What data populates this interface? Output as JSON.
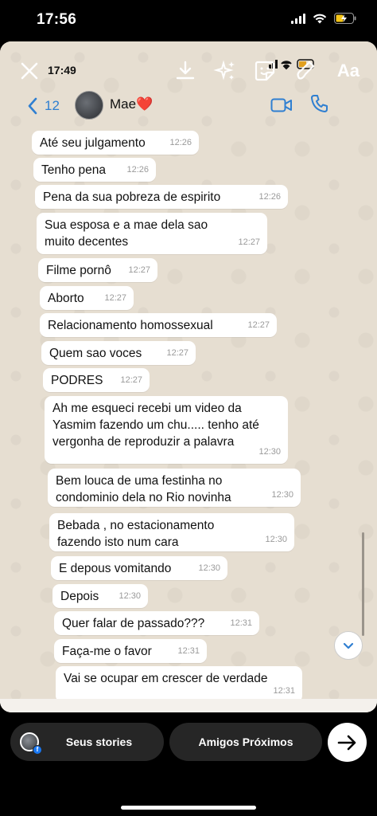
{
  "status_bar": {
    "time": "17:56"
  },
  "story_overlay": {
    "inner_time": "17:49",
    "text_tool_label": "Aa"
  },
  "chat_header": {
    "back_count": "12",
    "contact_name": "Mae",
    "contact_emoji": "❤️"
  },
  "messages": [
    {
      "text": "Até seu julgamento",
      "time": "12:26"
    },
    {
      "text": "Tenho pena",
      "time": "12:26"
    },
    {
      "text": "Pena da sua pobreza de espirito",
      "time": "12:26"
    },
    {
      "text": "Sua esposa e a mae dela sao muito decentes",
      "time": "12:27"
    },
    {
      "text": "Filme pornô",
      "time": "12:27"
    },
    {
      "text": "Aborto",
      "time": "12:27"
    },
    {
      "text": "Relacionamento homossexual",
      "time": "12:27"
    },
    {
      "text": "Quem sao voces",
      "time": "12:27"
    },
    {
      "text": "PODRES",
      "time": "12:27"
    },
    {
      "text": "Ah me esqueci recebi um video da Yasmim fazendo um chu..... tenho até vergonha de reproduzir a palavra",
      "time": "12:30"
    },
    {
      "text": "Bem louca de uma festinha no condominio dela no Rio novinha",
      "time": "12:30"
    },
    {
      "text": "Bebada , no estacionamento fazendo isto num cara",
      "time": "12:30"
    },
    {
      "text": "E depous vomitando",
      "time": "12:30"
    },
    {
      "text": "Depois",
      "time": "12:30"
    },
    {
      "text": "Quer falar de passado???",
      "time": "12:31"
    },
    {
      "text": "Faça-me o favor",
      "time": "12:31"
    },
    {
      "text": "Vai se ocupar em crescer de verdade",
      "time": "12:31"
    }
  ],
  "bottom_bar": {
    "your_stories_label": "Seus stories",
    "close_friends_label": "Amigos Próximos"
  },
  "colors": {
    "whatsapp_blue": "#2f7fd1",
    "heart_red": "#e0242b",
    "chat_bg": "#e6ded1",
    "pill_bg": "#262626"
  },
  "icons": [
    "close-icon",
    "download-icon",
    "sparkle-effects-icon",
    "sticker-icon",
    "draw-icon",
    "back-chevron-icon",
    "video-call-icon",
    "phone-call-icon",
    "scroll-down-icon",
    "send-arrow-icon"
  ]
}
